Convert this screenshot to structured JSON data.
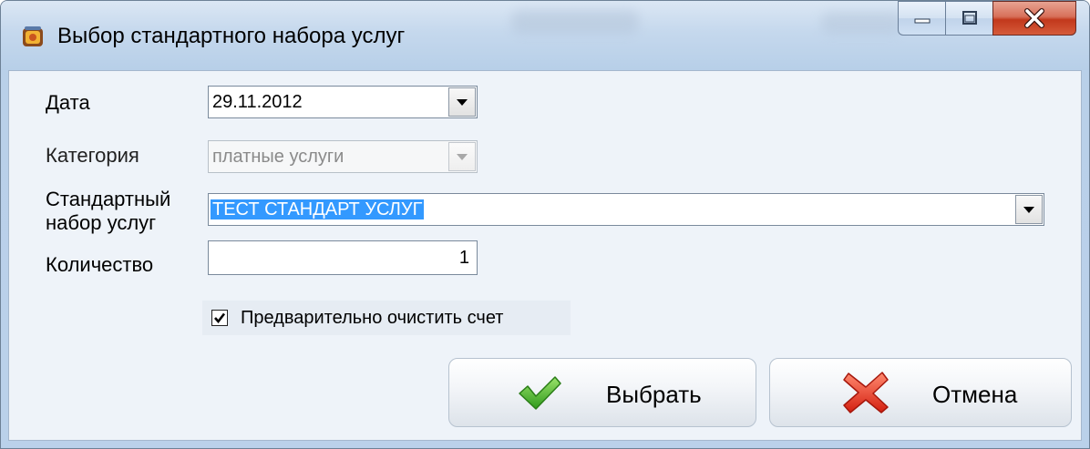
{
  "window": {
    "title": "Выбор стандартного набора услуг"
  },
  "form": {
    "date": {
      "label": "Дата",
      "value": "29.11.2012"
    },
    "category": {
      "label": "Категория",
      "value": "платные услуги",
      "enabled": false
    },
    "service_set": {
      "label_line1": "Стандартный",
      "label_line2": "набор услуг",
      "value": "ТЕСТ СТАНДАРТ УСЛУГ"
    },
    "quantity": {
      "label": "Количество",
      "value": "1"
    },
    "clear_account": {
      "label": "Предварительно очистить счет",
      "checked": true
    }
  },
  "buttons": {
    "select_label": "Выбрать",
    "cancel_label": "Отмена"
  },
  "colors": {
    "selection": "#3399ff",
    "close_button": "#c2381c",
    "check_icon": "#4caf2f",
    "cancel_icon": "#e53522"
  }
}
